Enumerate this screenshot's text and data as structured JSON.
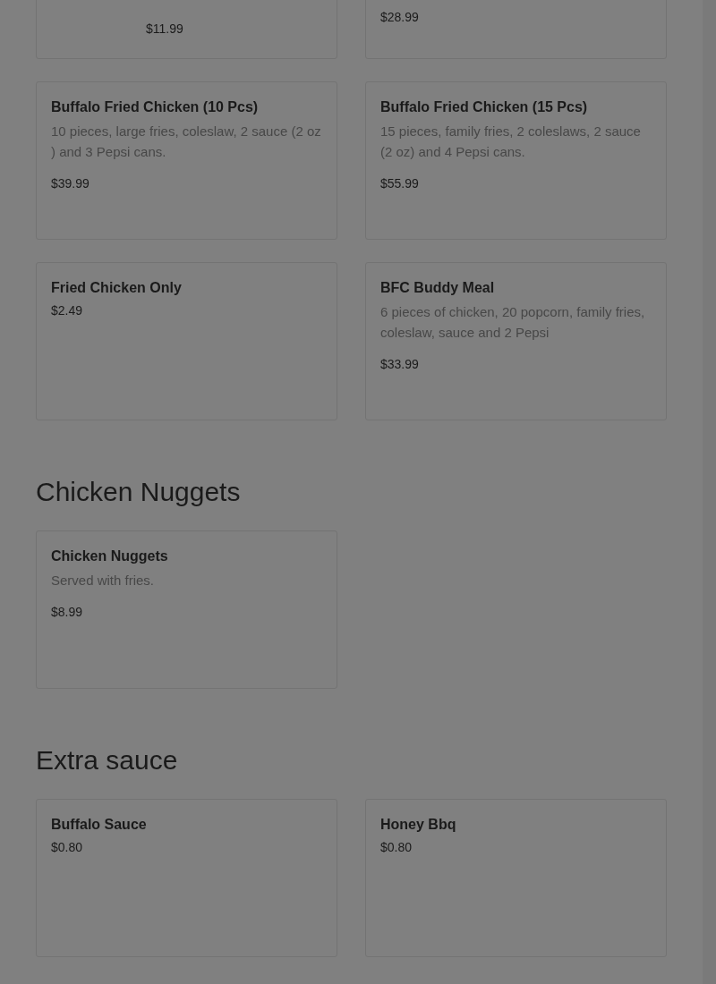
{
  "sections": [
    {
      "items": [
        {
          "kind": "offset_price",
          "price": "$11.99"
        },
        {
          "kind": "price_only",
          "price": "$28.99"
        },
        {
          "kind": "full",
          "name": "Buffalo Fried Chicken (10 Pcs)",
          "description": "10 pieces, large fries, coleslaw, 2 sauce (2 oz ) and 3 Pepsi cans.",
          "price": "$39.99"
        },
        {
          "kind": "full",
          "name": "Buffalo Fried Chicken (15 Pcs)",
          "description": "15 pieces, family fries, 2 coleslaws, 2 sauce (2 oz) and 4 Pepsi cans.",
          "price": "$55.99"
        },
        {
          "kind": "full",
          "name": "Fried Chicken Only",
          "price": "$2.49"
        },
        {
          "kind": "full",
          "name": "BFC Buddy Meal",
          "description": "6 pieces of chicken, 20 popcorn, family fries, coleslaw, sauce and 2 Pepsi",
          "price": "$33.99"
        }
      ]
    },
    {
      "heading": "Chicken Nuggets",
      "items": [
        {
          "kind": "full",
          "name": "Chicken Nuggets",
          "description": "Served with fries.",
          "price": "$8.99"
        }
      ]
    },
    {
      "heading": "Extra sauce",
      "items": [
        {
          "kind": "full",
          "name": "Buffalo Sauce",
          "price": "$0.80"
        },
        {
          "kind": "full",
          "name": "Honey Bbq",
          "price": "$0.80"
        }
      ]
    }
  ]
}
